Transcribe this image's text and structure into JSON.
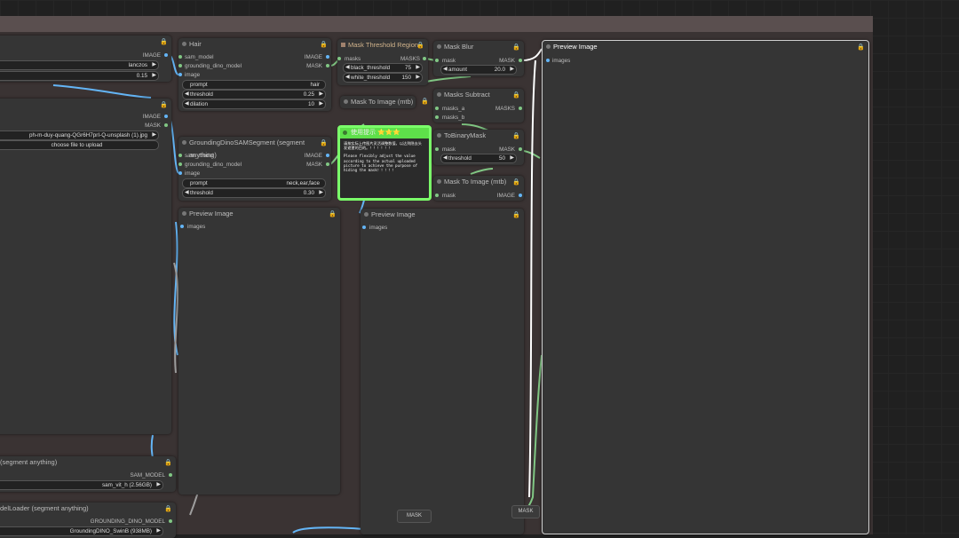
{
  "colors": {
    "image_slot": "#64b5f6",
    "mask_slot": "#81c784",
    "model_slot": "#aaaaaa",
    "lock": "#e2b33b",
    "note_border": "#7bff6a"
  },
  "node_left_top": {
    "out_image": "IMAGE",
    "out_mask": "MASK",
    "w_upscale": "lanczos",
    "w_scale": "0.15"
  },
  "node_load_image": {
    "out_image": "IMAGE",
    "out_mask": "MASK",
    "w_image": "ph-m-duy-quang-QGr6H7prI-Q-unsplash (1).jpg",
    "w_upload": "choose file to upload"
  },
  "node_sam_loader": {
    "title": "(segment anything)",
    "out": "SAM_MODEL",
    "w_model": "sam_vit_h (2.56GB)"
  },
  "node_dino_loader": {
    "title": "delLoader (segment anything)",
    "out": "GROUNDING_DINO_MODEL",
    "w_model": "GroundingDINO_SwinB (938MB)"
  },
  "node_hair": {
    "title": "Hair",
    "in_sam": "sam_model",
    "in_dino": "grounding_dino_model",
    "in_image": "image",
    "out_image": "IMAGE",
    "out_mask": "MASK",
    "prompt_label": "prompt",
    "prompt_value": "hair",
    "threshold_label": "threshold",
    "threshold_value": "0.25",
    "dilation_label": "dilation",
    "dilation_value": "10"
  },
  "node_gdsam": {
    "title": "GroundingDinoSAMSegment (segment anything)",
    "in_sam": "sam_model",
    "in_dino": "grounding_dino_model",
    "in_image": "image",
    "out_image": "IMAGE",
    "out_mask": "MASK",
    "prompt_label": "prompt",
    "prompt_value": "neck,ear,face",
    "threshold_label": "threshold",
    "threshold_value": "0.30"
  },
  "node_preview1": {
    "title": "Preview Image",
    "in_images": "images"
  },
  "node_mask_threshold": {
    "title": "Mask Threshold Region",
    "in_masks": "masks",
    "out_masks": "MASKS",
    "black_label": "black_threshold",
    "black_value": "75",
    "white_label": "white_threshold",
    "white_value": "150"
  },
  "node_mask_to_image1": {
    "title": "Mask To Image (mtb)"
  },
  "node_note": {
    "title": "使用提示 ⭐⭐⭐",
    "text_cn": "请按实际上传图片灵活调整数值，以达到隐去头发遮罩的目的。！！！！！！",
    "text_en": "Please flexibly adjust the value according to the actual uploaded picture to achieve the purpose of hiding the mask！！！！！"
  },
  "node_preview2": {
    "title": "Preview Image",
    "in_images": "images"
  },
  "node_mask_blur": {
    "title": "Mask Blur",
    "in_mask": "mask",
    "out_mask": "MASK",
    "amount_label": "amount",
    "amount_value": "20.0"
  },
  "node_masks_subtract": {
    "title": "Masks Subtract",
    "in_a": "masks_a",
    "in_b": "masks_b",
    "out": "MASKS"
  },
  "node_to_binary": {
    "title": "ToBinaryMask",
    "in_mask": "mask",
    "out_mask": "MASK",
    "threshold_label": "threshold",
    "threshold_value": "50"
  },
  "node_mask_to_image2": {
    "title": "Mask To Image (mtb)",
    "in_mask": "mask",
    "out_image": "IMAGE"
  },
  "node_preview_main": {
    "title": "Preview Image",
    "in_images": "images"
  },
  "reroute1": "MASK",
  "reroute2": "MASK"
}
